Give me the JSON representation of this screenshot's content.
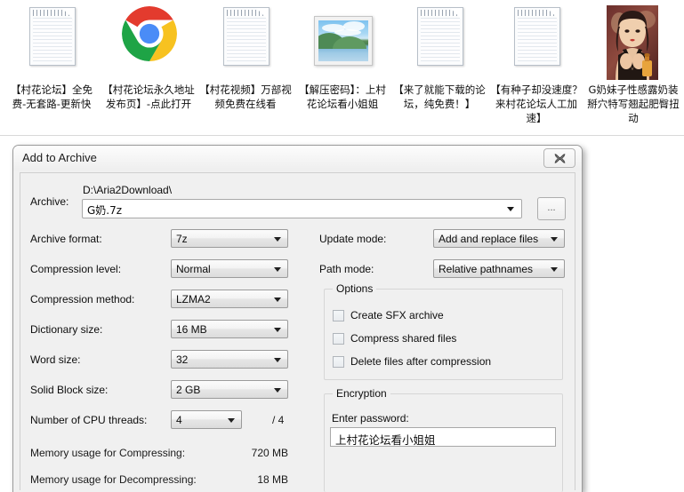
{
  "desktop": {
    "icons": [
      {
        "label": "【村花论坛】全免费-无套路-更新快",
        "icon": "text-document-icon",
        "type": "document"
      },
      {
        "label": "【村花论坛永久地址发布页】-点此打开",
        "icon": "chrome-browser-icon",
        "type": "chrome"
      },
      {
        "label": "【村花视频】万部视频免费在线看",
        "icon": "text-document-icon",
        "type": "document"
      },
      {
        "label": "【解压密码】：上村花论坛看小姐姐",
        "icon": "landscape-photo-icon",
        "type": "photo"
      },
      {
        "label": "【来了就能下载的论坛，纯免费！】",
        "icon": "text-document-icon",
        "type": "document"
      },
      {
        "label": "【有种子却没速度？来村花论坛人工加速】",
        "icon": "text-document-icon",
        "type": "document"
      },
      {
        "label": "G奶妹子性感露奶装 掰穴特写翘起肥臀扭动",
        "icon": "portrait-photo-icon",
        "type": "portrait"
      }
    ]
  },
  "dialog": {
    "title": "Add to Archive",
    "close_glyph": "close-icon",
    "archive": {
      "label": "Archive:",
      "path": "D:\\Aria2Download\\",
      "name": "G奶.7z",
      "browse_label": "...",
      "dropdown_icon": "chevron-down-icon"
    },
    "left_fields": [
      {
        "label": "Archive format:",
        "value": "7z"
      },
      {
        "label": "Compression level:",
        "value": "Normal"
      },
      {
        "label": "Compression method:",
        "value": "LZMA2"
      },
      {
        "label": "Dictionary size:",
        "value": "16 MB"
      },
      {
        "label": "Word size:",
        "value": "32"
      },
      {
        "label": "Solid Block size:",
        "value": "2 GB"
      },
      {
        "label": "Number of CPU threads:",
        "value": "4"
      }
    ],
    "cpu_threads_total": "/ 4",
    "memory": [
      {
        "label": "Memory usage for Compressing:",
        "value": "720 MB"
      },
      {
        "label": "Memory usage for Decompressing:",
        "value": "18 MB"
      }
    ],
    "right_fields": [
      {
        "label": "Update mode:",
        "value": "Add and replace files"
      },
      {
        "label": "Path mode:",
        "value": "Relative pathnames"
      }
    ],
    "options": {
      "title": "Options",
      "items": [
        {
          "label": "Create SFX archive",
          "checked": false
        },
        {
          "label": "Compress shared files",
          "checked": false
        },
        {
          "label": "Delete files after compression",
          "checked": false
        }
      ]
    },
    "encryption": {
      "title": "Encryption",
      "password_label": "Enter password:",
      "password_value": "上村花论坛看小姐姐"
    }
  },
  "colors": {
    "dialog_face": "#f0f0f0",
    "titlebar": "#f7f7f7",
    "field_border": "#9b9b9b",
    "text": "#0d0d0d",
    "chrome_red": "#e33b2e",
    "chrome_yellow": "#f7c220",
    "chrome_green": "#1ea446",
    "chrome_blue": "#4a8cf7"
  }
}
